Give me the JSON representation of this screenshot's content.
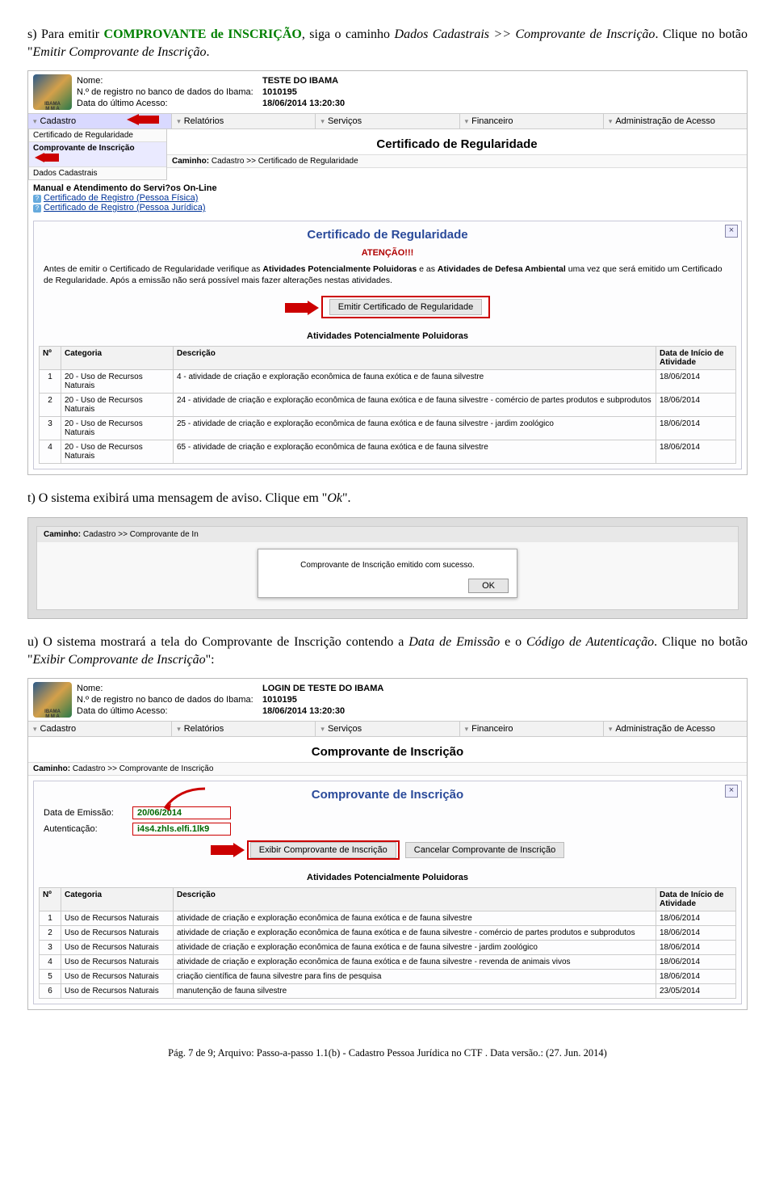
{
  "instr_s": {
    "prefix": "s) Para emitir ",
    "green": "COMPROVANTE de INSCRIÇÃO",
    "mid": ", siga o caminho ",
    "path": "Dados Cadastrais >> Comprovante de Inscrição",
    "after": ". Clique no botão \"",
    "btn": "Emitir Comprovante de Inscrição",
    "end": "."
  },
  "instr_t": {
    "text": "t) O sistema exibirá uma mensagem de aviso. Clique em \"",
    "ok": "Ok",
    "end": "\"."
  },
  "instr_u": {
    "text": "u) O sistema mostrará a tela do Comprovante de Inscrição contendo a ",
    "d1": "Data de Emissão",
    "mid": " e o ",
    "d2": "Código de Autenticação",
    "after": ". Clique no botão \"",
    "btn": "Exibir Comprovante de Inscrição",
    "end": "\":"
  },
  "sc1": {
    "nome_lab": "Nome:",
    "nome_val": "TESTE DO IBAMA",
    "reg_lab": "N.º de registro no banco de dados do Ibama:",
    "reg_val": "1010195",
    "date_lab": "Data do último Acesso:",
    "date_val": "18/06/2014 13:20:30",
    "tabs": [
      "Cadastro",
      "Relatórios",
      "Serviços",
      "Financeiro",
      "Administração de Acesso"
    ],
    "submenu": [
      "Certificado de Regularidade",
      "Comprovante de Inscrição",
      "Dados Cadastrais"
    ],
    "page_title": "Certificado de Regularidade",
    "caminho_lab": "Caminho:",
    "caminho": "Cadastro >> Certificado de Regularidade",
    "manual": "Manual e Atendimento do Servi?os On-Line",
    "link1": "Certificado de Registro (Pessoa Física)",
    "link2": "Certificado de Registro (Pessoa Jurídica)",
    "panel_title": "Certificado de Regularidade",
    "atencao": "ATENÇÃO!!!",
    "warn1": "Antes de emitir o Certificado de Regularidade verifique as ",
    "warn_b1": "Atividades Potencialmente Poluidoras",
    "warn_mid": " e as ",
    "warn_b2": "Atividades de Defesa Ambiental",
    "warn_end": " uma vez que será emitido um Certificado de Regularidade. Após a emissão não será possível mais fazer alterações nestas atividades.",
    "btn_emit": "Emitir Certificado de Regularidade",
    "tbl_title": "Atividades Potencialmente Poluidoras",
    "th": [
      "Nº",
      "Categoria",
      "Descrição",
      "Data de Início de Atividade"
    ],
    "rows": [
      {
        "n": "1",
        "cat": "20 - Uso de Recursos Naturais",
        "desc": "4 - atividade de criação e exploração econômica de fauna exótica e de fauna silvestre",
        "dt": "18/06/2014"
      },
      {
        "n": "2",
        "cat": "20 - Uso de Recursos Naturais",
        "desc": "24 - atividade de criação e exploração econômica de fauna exótica e de fauna silvestre - comércio de partes produtos e subprodutos",
        "dt": "18/06/2014"
      },
      {
        "n": "3",
        "cat": "20 - Uso de Recursos Naturais",
        "desc": "25 - atividade de criação e exploração econômica de fauna exótica e de fauna silvestre - jardim zoológico",
        "dt": "18/06/2014"
      },
      {
        "n": "4",
        "cat": "20 - Uso de Recursos Naturais",
        "desc": "65 - atividade de criação e exploração econômica de fauna exótica e de fauna silvestre",
        "dt": "18/06/2014"
      }
    ]
  },
  "dlg": {
    "caminho_lab": "Caminho:",
    "caminho": "Cadastro >> Comprovante de In",
    "msg": "Comprovante de Inscrição emitido com sucesso.",
    "ok": "OK"
  },
  "sc2": {
    "nome_lab": "Nome:",
    "nome_val": "LOGIN DE TESTE DO IBAMA",
    "reg_lab": "N.º de registro no banco de dados do Ibama:",
    "reg_val": "1010195",
    "date_lab": "Data do último Acesso:",
    "date_val": "18/06/2014 13:20:30",
    "tabs": [
      "Cadastro",
      "Relatórios",
      "Serviços",
      "Financeiro",
      "Administração de Acesso"
    ],
    "page_title": "Comprovante de Inscrição",
    "caminho_lab": "Caminho:",
    "caminho": "Cadastro >> Comprovante de Inscrição",
    "panel_title": "Comprovante de Inscrição",
    "emissao_lab": "Data de Emissão:",
    "emissao_val": "20/06/2014",
    "auth_lab": "Autenticação:",
    "auth_val": "i4s4.zhls.elfi.1lk9",
    "btn_exibir": "Exibir Comprovante de Inscrição",
    "btn_cancel": "Cancelar Comprovante de Inscrição",
    "tbl_title": "Atividades Potencialmente Poluidoras",
    "th": [
      "Nº",
      "Categoria",
      "Descrição",
      "Data de Início de Atividade"
    ],
    "rows": [
      {
        "n": "1",
        "cat": "Uso de Recursos Naturais",
        "desc": "atividade de criação e exploração econômica de fauna exótica e de fauna silvestre",
        "dt": "18/06/2014"
      },
      {
        "n": "2",
        "cat": "Uso de Recursos Naturais",
        "desc": "atividade de criação e exploração econômica de fauna exótica e de fauna silvestre - comércio de partes produtos e subprodutos",
        "dt": "18/06/2014"
      },
      {
        "n": "3",
        "cat": "Uso de Recursos Naturais",
        "desc": "atividade de criação e exploração econômica de fauna exótica e de fauna silvestre - jardim zoológico",
        "dt": "18/06/2014"
      },
      {
        "n": "4",
        "cat": "Uso de Recursos Naturais",
        "desc": "atividade de criação e exploração econômica de fauna exótica e de fauna silvestre - revenda de animais vivos",
        "dt": "18/06/2014"
      },
      {
        "n": "5",
        "cat": "Uso de Recursos Naturais",
        "desc": "criação científica de fauna silvestre para fins de pesquisa",
        "dt": "18/06/2014"
      },
      {
        "n": "6",
        "cat": "Uso de Recursos Naturais",
        "desc": "manutenção de fauna silvestre",
        "dt": "23/05/2014"
      }
    ]
  },
  "footer": "Pág. 7 de 9; Arquivo: Passo-a-passo 1.1(b) - Cadastro Pessoa Jurídica no CTF . Data versão.: (27. Jun. 2014)"
}
